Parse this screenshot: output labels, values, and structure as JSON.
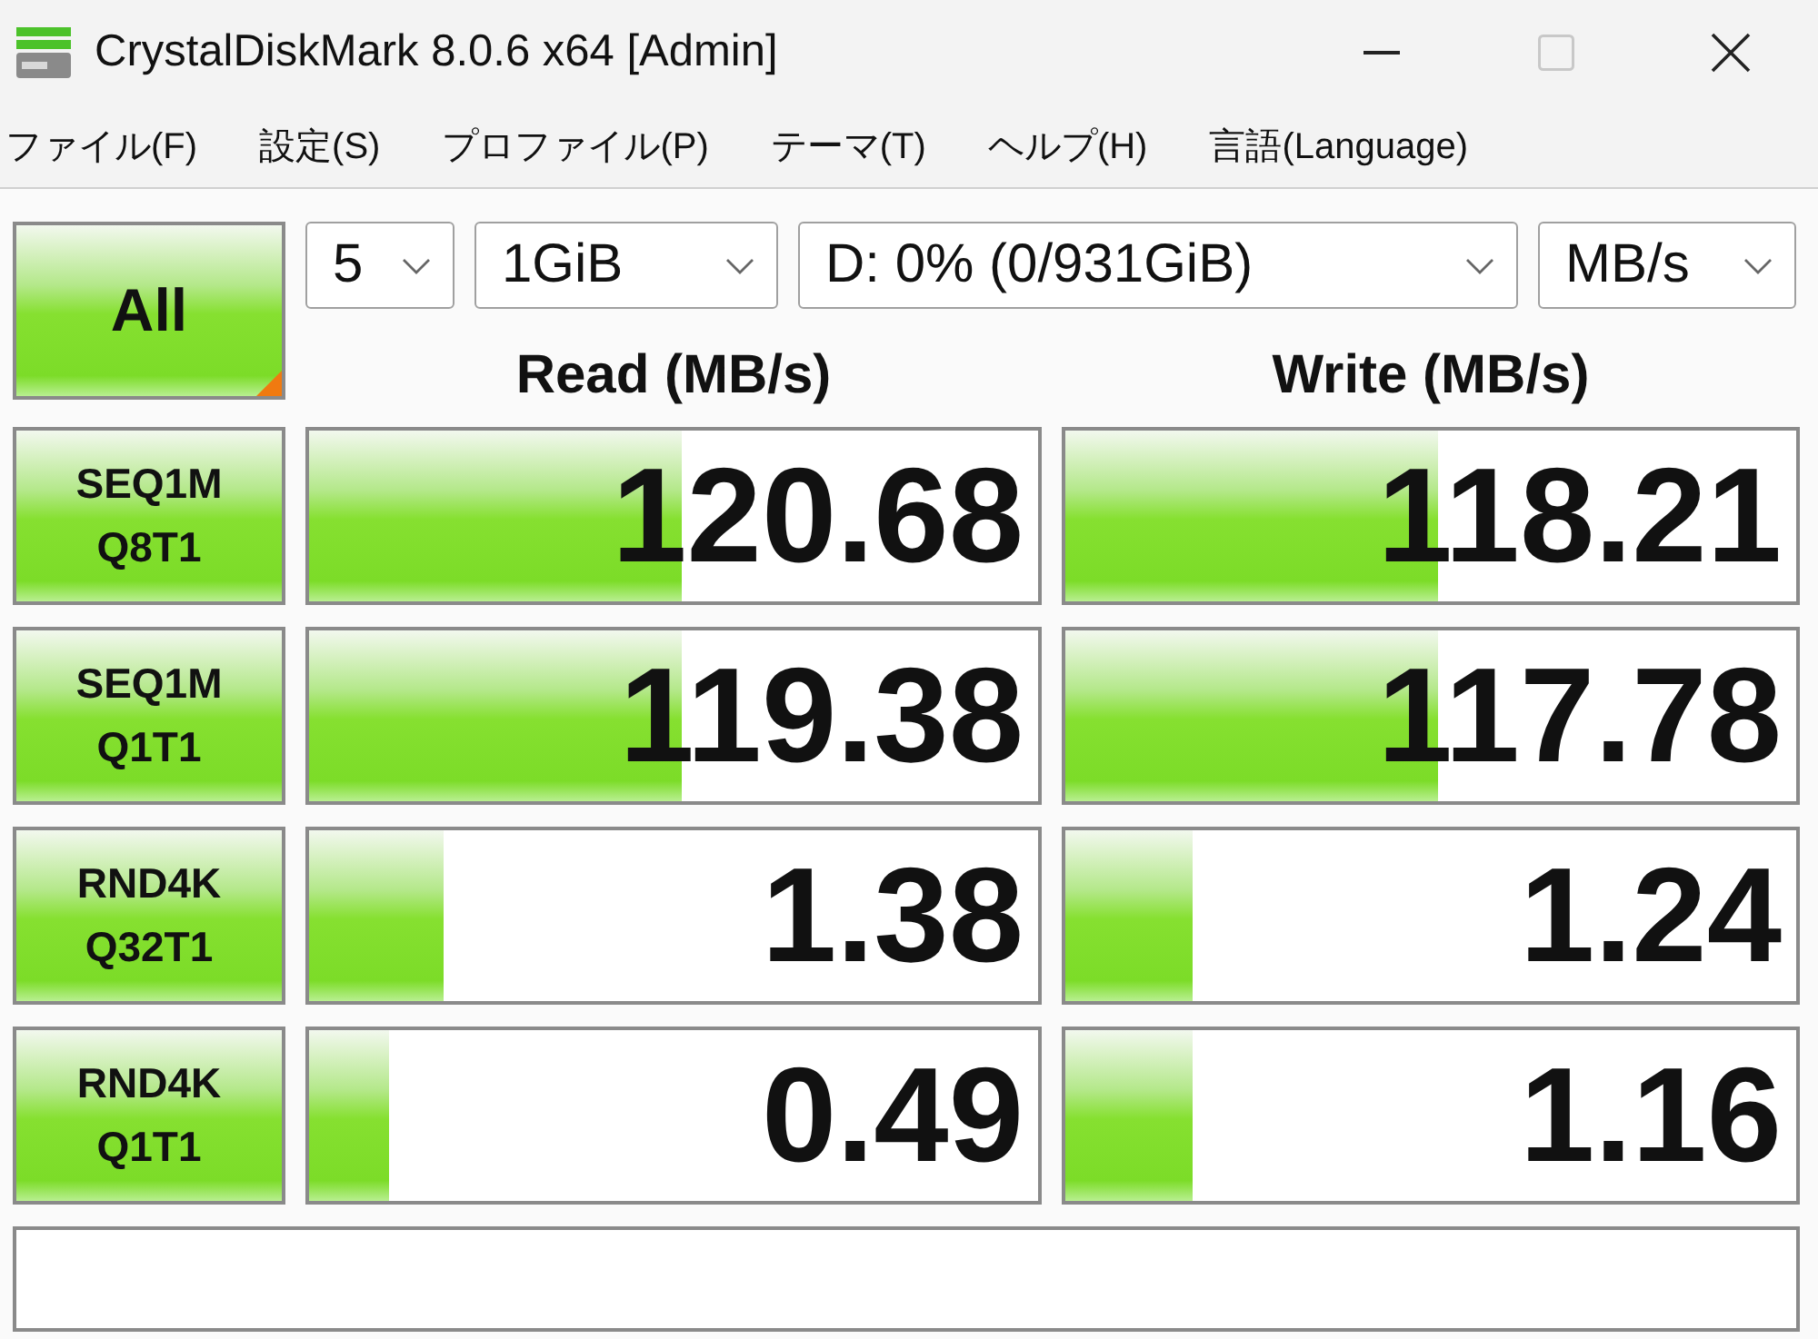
{
  "window": {
    "title": "CrystalDiskMark 8.0.6 x64 [Admin]",
    "maximize_disabled": true
  },
  "menu": [
    {
      "label": "ファイル(F)"
    },
    {
      "label": "設定(S)"
    },
    {
      "label": "プロファイル(P)"
    },
    {
      "label": "テーマ(T)"
    },
    {
      "label": "ヘルプ(H)"
    },
    {
      "label": "言語(Language)"
    }
  ],
  "all_button": {
    "label": "All"
  },
  "selectors": [
    {
      "value": "5"
    },
    {
      "value": "1GiB"
    },
    {
      "value": "D: 0% (0/931GiB)"
    },
    {
      "value": "MB/s"
    }
  ],
  "columns": [
    {
      "label": "Read (MB/s)"
    },
    {
      "label": "Write (MB/s)"
    }
  ],
  "tests": [
    {
      "name": "SEQ1M",
      "params": "Q8T1",
      "read": {
        "value": "120.68",
        "level": 0.51
      },
      "write": {
        "value": "118.21",
        "level": 0.51
      }
    },
    {
      "name": "SEQ1M",
      "params": "Q1T1",
      "read": {
        "value": "119.38",
        "level": 0.51
      },
      "write": {
        "value": "117.78",
        "level": 0.51
      }
    },
    {
      "name": "RND4K",
      "params": "Q32T1",
      "read": {
        "value": "1.38",
        "level": 0.185
      },
      "write": {
        "value": "1.24",
        "level": 0.175
      }
    },
    {
      "name": "RND4K",
      "params": "Q1T1",
      "read": {
        "value": "0.49",
        "level": 0.11
      },
      "write": {
        "value": "1.16",
        "level": 0.175
      }
    }
  ]
}
